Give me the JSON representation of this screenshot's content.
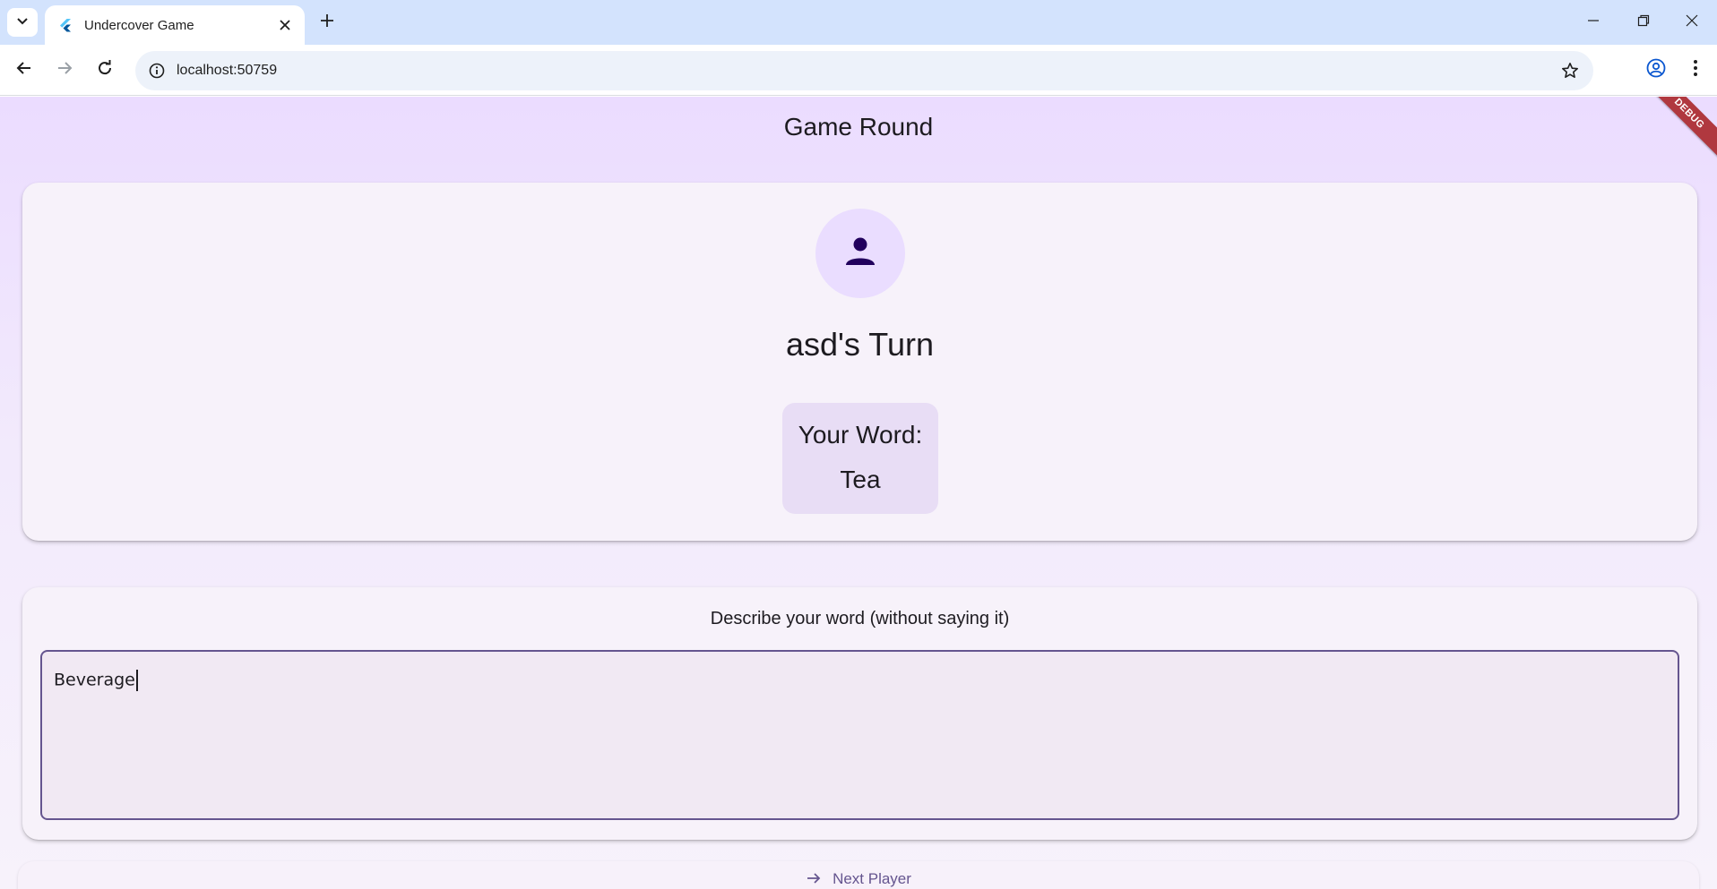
{
  "browser": {
    "tab_title": "Undercover Game",
    "url": "localhost:50759"
  },
  "app": {
    "title": "Game Round",
    "debug_banner": "DEBUG",
    "player": {
      "turn_text": "asd's Turn",
      "word_label": "Your Word:",
      "word": "Tea"
    },
    "describe": {
      "prompt": "Describe your word (without saying it)",
      "value": "Beverage"
    },
    "next_button_label": "Next Player"
  },
  "colors": {
    "accent": "#65558f",
    "avatar_bg": "#eaddff",
    "avatar_icon": "#21005d",
    "debug_banner": "#b0383f",
    "card_bg": "#f7f2fa"
  },
  "icons": {
    "tab_search": "chevron-down-icon",
    "favicon": "flutter-icon",
    "tab_close": "close-icon",
    "new_tab": "plus-icon",
    "minimize": "minimize-icon",
    "restore": "restore-icon",
    "close_window": "close-icon",
    "back": "arrow-left-icon",
    "forward": "arrow-right-icon",
    "reload": "reload-icon",
    "site_info": "info-icon",
    "bookmark": "star-icon",
    "profile": "account-icon",
    "menu": "more-vertical-icon",
    "avatar": "person-icon",
    "next": "arrow-right-icon"
  }
}
